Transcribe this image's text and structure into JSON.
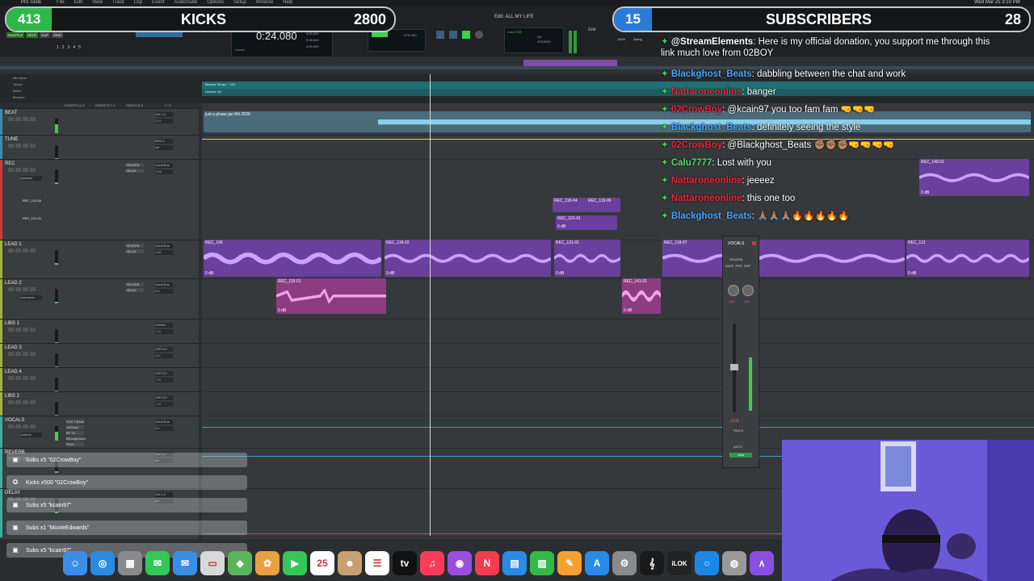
{
  "menu": {
    "app": "Pro Tools",
    "items": [
      "File",
      "Edit",
      "View",
      "Track",
      "Clip",
      "Event",
      "AudioSuite",
      "Options",
      "Setup",
      "Window",
      "Help"
    ],
    "window_title": "Edit: ALL MY LIFE",
    "clock": "Wed Mar 25  3:10 PM"
  },
  "transport": {
    "main_counter": "0:24.080",
    "start": "0:00.000",
    "end": "0:18.040",
    "length": "0:00.000",
    "nudge": "0:01.000",
    "count_off": "Count Off",
    "meter": "4/4",
    "tempo": "103.0000",
    "cursor": "Cursor",
    "grid": "Grid",
    "strength": "100%",
    "swing": "Swing",
    "modes": [
      "SHUFFLE",
      "SPOT",
      "SLIP",
      "GRID"
    ]
  },
  "overlays": {
    "kicks": {
      "count": "413",
      "label": "KICKS",
      "goal": "2800"
    },
    "subs": {
      "count": "15",
      "label": "SUBSCRIBERS",
      "goal": "28"
    }
  },
  "rulers": {
    "labels": [
      "Min:Secs",
      "Tempo",
      "Meter",
      "Markers"
    ],
    "tempo_text": "Manual Tempo: ~103",
    "meter_text": "Default: 4/4"
  },
  "column_headers": [
    "INSERTS A-E",
    "INSERTS F-J",
    "SENDS A-E",
    "I / O"
  ],
  "tracks": [
    {
      "name": "BEAT",
      "color": "#3a8fb0",
      "io": "Out 1-2",
      "vol": "-2.4",
      "inserts": []
    },
    {
      "name": "TUNE",
      "color": "#3a8fb0",
      "io": "MICL1",
      "vol": "vol",
      "inserts": []
    },
    {
      "name": "REC",
      "color": "#d23a3a",
      "io": "Vocal Bus",
      "vol": "+3.0",
      "inserts": [
        "REVERB",
        "DELAY"
      ],
      "playlist": "playlists",
      "sub1": "REC_110-06",
      "sub2": "REC_121-01"
    },
    {
      "name": "LEAD 1",
      "color": "#a4b23a",
      "io": "Vocal Bus",
      "vol": "-0.8",
      "inserts": [
        "REVERB",
        "DELAY"
      ]
    },
    {
      "name": "LEAD 2",
      "color": "#a4b23a",
      "io": "Vocal Bus",
      "vol": "0.0",
      "inserts": [
        "REVERB",
        "DELAY"
      ],
      "view": "waveform"
    },
    {
      "name": "LIBS 1",
      "color": "#a4b23a",
      "io": "VirtuBs",
      "vol": "-7.2",
      "inserts": []
    },
    {
      "name": "LEAD 3",
      "color": "#a4b23a",
      "io": "VIRTUO",
      "vol": "-6.7",
      "inserts": []
    },
    {
      "name": "LEAD 4",
      "color": "#a4b23a",
      "io": "VIRTUO",
      "vol": "-7.9",
      "inserts": []
    },
    {
      "name": "LIBS 2",
      "color": "#a4b23a",
      "io": "VIRTUO",
      "vol": "-7.9",
      "inserts": []
    },
    {
      "name": "VOCALS",
      "color": "#3ab0a0",
      "io": "Vocal Bus",
      "vol": "0.0",
      "inserts": [
        "EQ3 7-Band",
        "DeEsser",
        "BF-76",
        "BCompressor",
        "RVox"
      ],
      "view": "volume"
    },
    {
      "name": "REVERB",
      "color": "#3ab0a0",
      "io": "Out 1-2",
      "vol": "vol",
      "inserts": []
    },
    {
      "name": "DELAY",
      "color": "#3ab0a0",
      "io": "Out 1-2",
      "vol": "vol",
      "inserts": []
    }
  ],
  "clips": {
    "beat_label": "just a phase jan 6th 2026",
    "rec_a": "REC_118-04",
    "rec_b": "REC_119-06",
    "rec_c": "REC_121-01",
    "rec_right": "REC_149-01",
    "lead1_a": "REC_106",
    "lead1_b": "REC_118-02",
    "lead1_c": "REC_131-01",
    "lead1_d": "REC_118-07",
    "lead1_e": "REC_113",
    "lead2_a": "REC_115-01",
    "lead2_b": "REC_141-01",
    "db": "0 dB"
  },
  "chat": [
    {
      "user": "@StreamElements",
      "user_color": "#ffffff",
      "text": ": Here is my official donation, you support me through this",
      "line2": "link much love from 02BOY"
    },
    {
      "user": "Blackghost_Beats",
      "user_color": "#4aa3ff",
      "text": ": dabbling between the chat and work"
    },
    {
      "user": "Nattaroneonline",
      "user_color": "#e0283c",
      "text": ": banger"
    },
    {
      "user": "02CrowBoy",
      "user_color": "#e0283c",
      "text": ": @kcain97 you too fam fam 🤜🤜🤜"
    },
    {
      "user": "Blackghost_Beats",
      "user_color": "#4aa3ff",
      "text": ": definitely seeing the style"
    },
    {
      "user": "02CrowBoy",
      "user_color": "#e0283c",
      "text": ": @Blackghost_Beats ✊🏽✊🏽✊🏽🤜🤜🤜🤜"
    },
    {
      "user": "Calu7777",
      "user_color": "#58d86a",
      "text": ": Lost with you"
    },
    {
      "user": "Nattaroneonline",
      "user_color": "#e0283c",
      "text": ": jeeeez"
    },
    {
      "user": "Nattaroneonline",
      "user_color": "#e0283c",
      "text": ": this one too"
    },
    {
      "user": "Blackghost_Beats",
      "user_color": "#4aa3ff",
      "text": ": 🙏🏽🙏🏽🙏🏽🔥🔥🔥🔥🔥"
    }
  ],
  "mixer": {
    "name": "VOCALS",
    "insert": "REVERB",
    "labels": [
      "SAFE",
      "PRE",
      "FMP"
    ],
    "pan_l": "-100",
    "pan_r": "100",
    "fader_value": "-12.9",
    "track_label": "TRACK",
    "auto_label": "AUTO",
    "mode": "read"
  },
  "notifications": [
    {
      "text": "Subs x5 \"02CrowBoy\""
    },
    {
      "text": "Kicks x500 \"02CrowBoy\""
    },
    {
      "text": "Subs x5 \"kcain97\""
    },
    {
      "text": "Subs x1 \"MonieEdwards\""
    },
    {
      "text": "Subs x5 \"kcain97\""
    }
  ],
  "dock": [
    {
      "name": "finder",
      "glyph": "☺",
      "color": "#3b8ee8"
    },
    {
      "name": "safari",
      "glyph": "◎",
      "color": "#2a8be0"
    },
    {
      "name": "launchpad",
      "glyph": "▦",
      "color": "#8a8a8a"
    },
    {
      "name": "messages",
      "glyph": "✉",
      "color": "#34c759"
    },
    {
      "name": "mail",
      "glyph": "✉",
      "color": "#3a8ee6"
    },
    {
      "name": "files",
      "glyph": "▭",
      "color": "#d8d8d8"
    },
    {
      "name": "maps",
      "glyph": "◆",
      "color": "#5ab55a"
    },
    {
      "name": "photos",
      "glyph": "✿",
      "color": "#e8a040"
    },
    {
      "name": "facetime",
      "glyph": "▶",
      "color": "#35c759"
    },
    {
      "name": "calendar",
      "glyph": "25",
      "color": "#ffffff"
    },
    {
      "name": "contacts",
      "glyph": "☻",
      "color": "#c8a070"
    },
    {
      "name": "reminders",
      "glyph": "☰",
      "color": "#ffffff"
    },
    {
      "name": "tv",
      "glyph": "tv",
      "color": "#111111"
    },
    {
      "name": "music",
      "glyph": "♫",
      "color": "#fa3c5a"
    },
    {
      "name": "podcasts",
      "glyph": "◉",
      "color": "#9a4ee0"
    },
    {
      "name": "news",
      "glyph": "N",
      "color": "#f23c50"
    },
    {
      "name": "keynote",
      "glyph": "▤",
      "color": "#2a8ae8"
    },
    {
      "name": "numbers",
      "glyph": "▥",
      "color": "#34b84a"
    },
    {
      "name": "pages",
      "glyph": "✎",
      "color": "#f5a030"
    },
    {
      "name": "app-store",
      "glyph": "A",
      "color": "#2a8ae8"
    },
    {
      "name": "settings",
      "glyph": "⚙",
      "color": "#8a8a8a"
    },
    {
      "name": "audio-app",
      "glyph": "𝄞",
      "color": "#1a1a1a"
    },
    {
      "name": "ilok",
      "glyph": "iLOK",
      "color": "#222222"
    },
    {
      "name": "circle-app",
      "glyph": "○",
      "color": "#1a88e8"
    },
    {
      "name": "scanner",
      "glyph": "◍",
      "color": "#999999"
    },
    {
      "name": "avid",
      "glyph": "∧",
      "color": "#8a4ee0"
    }
  ]
}
